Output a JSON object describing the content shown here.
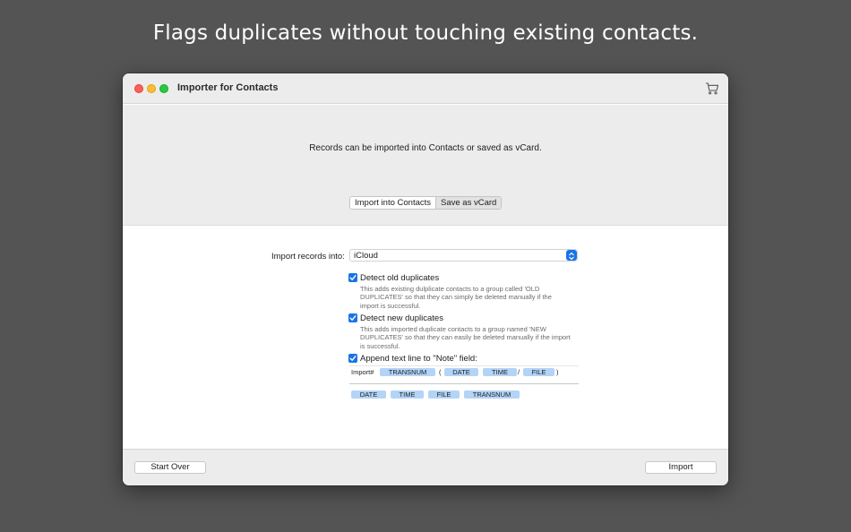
{
  "headline": "Flags duplicates without touching existing contacts.",
  "window": {
    "title": "Importer for Contacts",
    "cart_icon": "cart-icon"
  },
  "top_panel": {
    "message": "Records can be imported into Contacts or saved as vCard.",
    "segments": [
      "Import into Contacts",
      "Save as vCard"
    ]
  },
  "options": {
    "import_label": "Import records into:",
    "import_target": "iCloud",
    "detect_old": {
      "label": "Detect old duplicates",
      "checked": true,
      "desc_lines": [
        "This adds existing dulplicate contacts to a group called 'OLD",
        "DUPLICATES' so that they can simply be deleted manually if the",
        "import is successful."
      ]
    },
    "detect_new": {
      "label": "Detect new duplicates",
      "checked": true,
      "desc_lines": [
        "This adds imported duplicate contacts to a group named 'NEW",
        "DUPLICATES' so that they can easily be deleted manually if the import",
        "is successful."
      ]
    },
    "append_note": {
      "label": "Append text line to \"Note\" field:",
      "checked": true
    }
  },
  "note_line": {
    "prefix": "Import#",
    "tokens": [
      "TRANSNUM",
      "DATE",
      "TIME",
      "FILE"
    ],
    "open_paren": "(",
    "slash": "/",
    "close_paren": ")"
  },
  "available_tokens": [
    "DATE",
    "TIME",
    "FILE",
    "TRANSNUM"
  ],
  "footer": {
    "start_over": "Start Over",
    "import": "Import"
  }
}
